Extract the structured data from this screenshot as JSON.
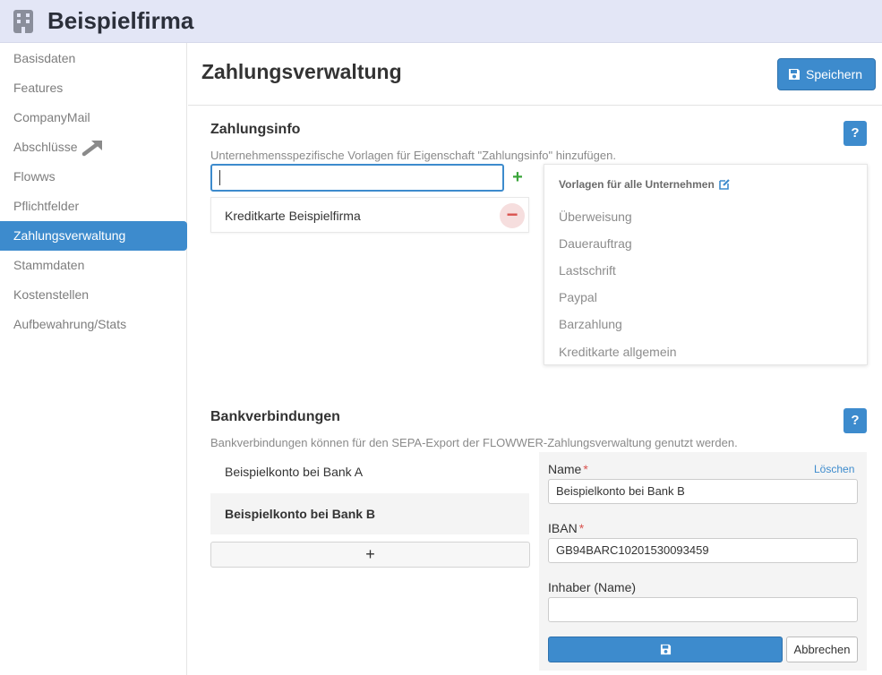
{
  "header": {
    "company_name": "Beispielfirma",
    "logo_icon": "building-icon"
  },
  "sidebar": {
    "items": [
      {
        "label": "Basisdaten",
        "active": false
      },
      {
        "label": "Features",
        "active": false
      },
      {
        "label": "CompanyMail",
        "active": false
      },
      {
        "label": "Abschlüsse",
        "active": false,
        "icon": "external-arrow-icon"
      },
      {
        "label": "Flowws",
        "active": false
      },
      {
        "label": "Pflichtfelder",
        "active": false
      },
      {
        "label": "Zahlungsverwaltung",
        "active": true
      },
      {
        "label": "Stammdaten",
        "active": false
      },
      {
        "label": "Kostenstellen",
        "active": false
      },
      {
        "label": "Aufbewahrung/Stats",
        "active": false
      }
    ]
  },
  "page": {
    "title": "Zahlungsverwaltung",
    "save_label": "Speichern"
  },
  "zahlungsinfo": {
    "title": "Zahlungsinfo",
    "help_label": "?",
    "description": "Unternehmensspezifische Vorlagen für Eigenschaft \"Zahlungsinfo\" hinzufügen.",
    "input_value": "",
    "add_label": "+",
    "items": [
      "Kreditkarte Beispielfirma"
    ],
    "remove_label": "−",
    "templates_title": "Vorlagen für alle Unternehmen",
    "templates": [
      "Überweisung",
      "Dauerauftrag",
      "Lastschrift",
      "Paypal",
      "Barzahlung",
      "Kreditkarte allgemein"
    ]
  },
  "bank": {
    "title": "Bankverbindungen",
    "help_label": "?",
    "description": "Bankverbindungen können für den SEPA-Export der FLOWWER-Zahlungsverwaltung genutzt werden.",
    "accounts": [
      {
        "label": "Beispielkonto bei Bank A",
        "selected": false
      },
      {
        "label": "Beispielkonto bei Bank B",
        "selected": true
      }
    ],
    "add_label": "+",
    "form": {
      "name_label": "Name",
      "required_mark": "*",
      "delete_label": "Löschen",
      "name_value": "Beispielkonto bei Bank B",
      "iban_label": "IBAN",
      "iban_value": "GB94BARC10201530093459",
      "holder_label": "Inhaber (Name)",
      "holder_value": "",
      "cancel_label": "Abbrechen"
    }
  },
  "colors": {
    "accent": "#3d8bcd",
    "topbar": "#e3e6f6",
    "add_green": "#3aa53a",
    "remove_red": "#d9534f"
  }
}
